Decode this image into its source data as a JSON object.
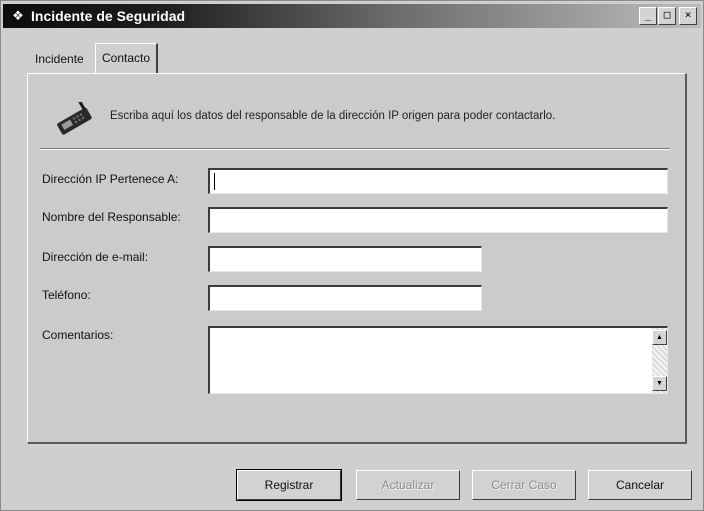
{
  "window": {
    "title": "Incidente de Seguridad",
    "controls": {
      "minimize": "_",
      "maximize": "□",
      "close": "×"
    }
  },
  "tabs": [
    {
      "label": "Incidente",
      "active": false
    },
    {
      "label": "Contacto",
      "active": true
    }
  ],
  "contact": {
    "instruction": "Escriba aquí los datos del responsable de la dirección IP origen para poder contactarlo.",
    "icon": "phone-icon",
    "fields": {
      "ip_owner": {
        "label": "Dirección IP Pertenece A:",
        "value": ""
      },
      "responsible_name": {
        "label": "Nombre del Responsable:",
        "value": ""
      },
      "email": {
        "label": "Dirección de e-mail:",
        "value": ""
      },
      "phone": {
        "label": "Teléfono:",
        "value": ""
      },
      "comments": {
        "label": "Comentarios:",
        "value": ""
      }
    }
  },
  "buttons": {
    "register": {
      "label": "Registrar",
      "enabled": true
    },
    "update": {
      "label": "Actualizar",
      "enabled": false
    },
    "close_case": {
      "label": "Cerrar Caso",
      "enabled": false
    },
    "cancel": {
      "label": "Cancelar",
      "enabled": true
    }
  },
  "colors": {
    "titlebar_start": "#0d0d0d",
    "titlebar_end": "#bdbdbd",
    "window_bg": "#cfcfcf"
  }
}
